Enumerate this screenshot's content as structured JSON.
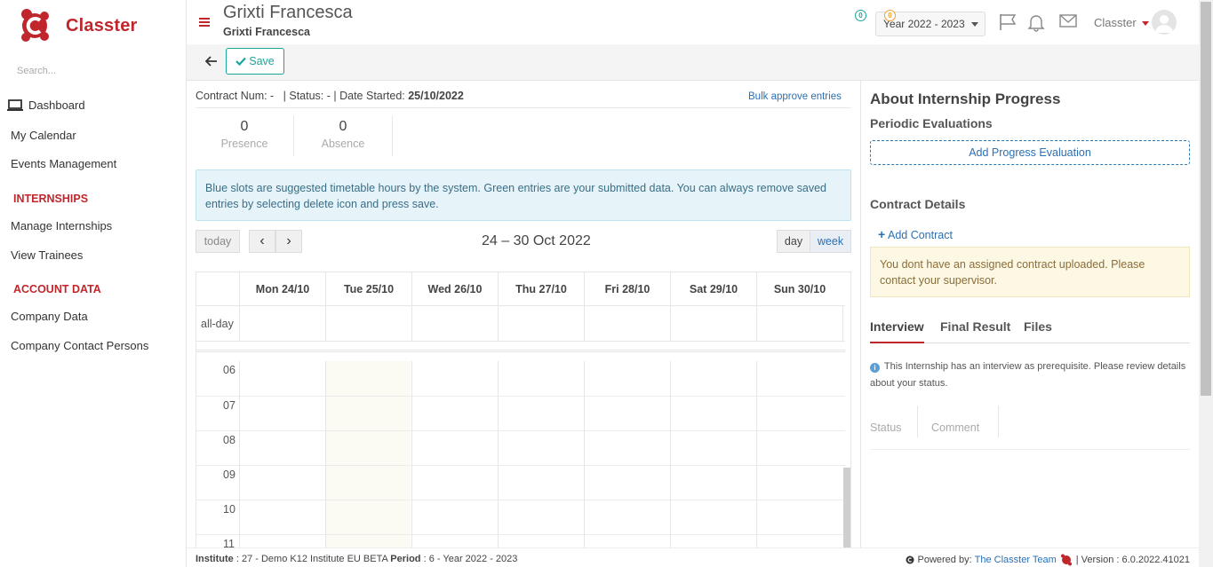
{
  "brand": {
    "name": "Classter"
  },
  "sidebar": {
    "search_placeholder": "Search...",
    "items": {
      "dashboard": "Dashboard",
      "my_calendar": "My Calendar",
      "events": "Events Management",
      "manage_internships": "Manage Internships",
      "view_trainees": "View Trainees",
      "company_data": "Company Data",
      "company_contacts": "Company Contact Persons"
    },
    "sections": {
      "internships": "INTERNSHIPS",
      "account_data": "ACCOUNT DATA"
    }
  },
  "header": {
    "title": "Grixti Francesca",
    "subtitle": "Grixti Francesca",
    "year": "Year 2022 - 2023",
    "notifications_count": "0",
    "messages_count": "0",
    "user": "Classter"
  },
  "toolbar": {
    "save_label": "Save"
  },
  "contract": {
    "num_label": "Contract Num: -",
    "status_label": "| Status: - | Date Started:",
    "date_started": "25/10/2022",
    "bulk_link": "Bulk approve entries"
  },
  "stats": {
    "presence_value": "0",
    "presence_label": "Presence",
    "absence_value": "0",
    "absence_label": "Absence"
  },
  "info_text": "Blue slots are suggested timetable hours by the system. Green entries are your submitted data. You can always remove saved entries by selecting delete icon and press save.",
  "calendar": {
    "today_label": "today",
    "prev": "‹",
    "next": "›",
    "range": "24 – 30 Oct 2022",
    "view_day": "day",
    "view_week": "week",
    "days": [
      "Mon 24/10",
      "Tue 25/10",
      "Wed 26/10",
      "Thu 27/10",
      "Fri 28/10",
      "Sat 29/10",
      "Sun 30/10"
    ],
    "allday_label": "all-day",
    "hours": [
      "06",
      "07",
      "08",
      "09",
      "10",
      "11"
    ]
  },
  "right_panel": {
    "title": "About Internship Progress",
    "periodic": "Periodic Evaluations",
    "add_eval": "Add Progress Evaluation",
    "contract_details": "Contract Details",
    "add_contract": "Add Contract",
    "warning": "You dont have an assigned contract uploaded. Please contact your supervisor.",
    "tabs": [
      "Interview",
      "Final Result",
      "Files"
    ],
    "interview_info": "This Internship has an interview as prerequisite. Please review details about your status.",
    "table_headers": [
      "Status",
      "Comment"
    ]
  },
  "footer": {
    "institute_label": "Institute",
    "institute_value": ": 27 - Demo K12 Institute EU BETA",
    "period_label": "Period",
    "period_value": ": 6 - Year 2022 - 2023",
    "powered_by": "Powered by:",
    "team": "The Classter Team",
    "version": "| Version : 6.0.2022.41021"
  },
  "colors": {
    "brand_red": "#c0272d",
    "accent_teal": "#1aa59a",
    "link_blue": "#2b70b4"
  }
}
